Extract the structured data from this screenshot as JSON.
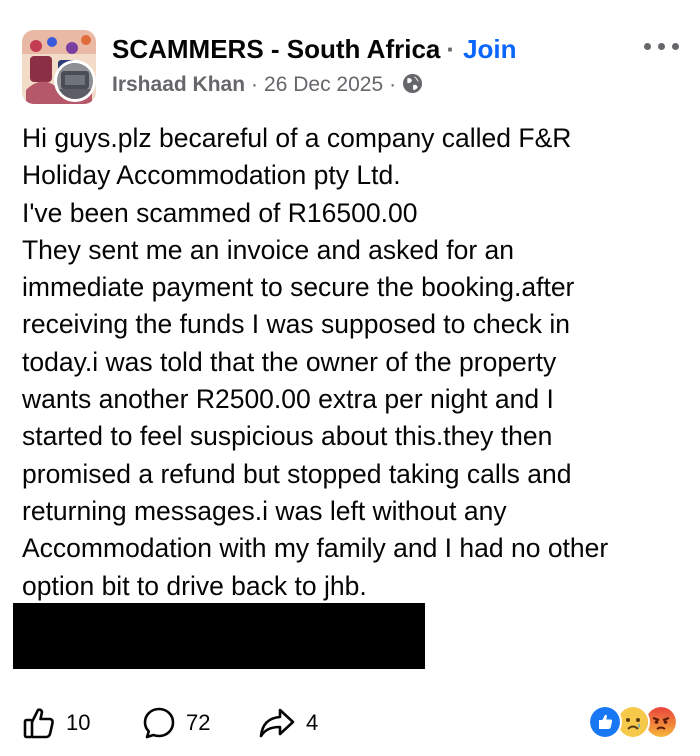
{
  "post": {
    "group_name": "SCAMMERS - South Africa",
    "separator": "·",
    "join_label": "Join",
    "author": "Irshaad Khan",
    "meta_separator": "·",
    "date": "26 Dec 2025",
    "privacy_icon": "globe-icon",
    "body": "Hi guys.plz becareful of a company called F&R\nHoliday Accommodation pty Ltd.\nI've been scammed of R16500.00\nThey sent me an invoice and asked for an\nimmediate payment to secure the booking.after\nreceiving the funds I was supposed to check in\ntoday.i was told that the owner of the property\nwants another R2500.00 extra per night and I\nstarted to feel suspicious about this.they then\npromised a refund but stopped taking calls and\nreturning messages.i was left without any\nAccommodation with my family and I had no other\noption bit to drive back to jhb."
  },
  "actions": {
    "like_count": "10",
    "comment_count": "72",
    "share_count": "4"
  },
  "reactions": [
    "like",
    "sad",
    "angry"
  ],
  "colors": {
    "join": "#0866ff",
    "secondary_text": "#65676b",
    "like_blue": "#1877f2",
    "redaction": "#000000"
  }
}
